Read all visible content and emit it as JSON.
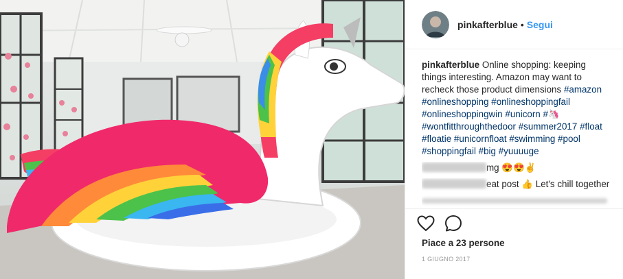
{
  "header": {
    "username": "pinkafterblue",
    "separator": "•",
    "follow_label": "Segui"
  },
  "caption": {
    "username": "pinkafterblue",
    "text": "Online shopping: keeping things interesting. Amazon may want to recheck those product dimensions",
    "hashtags": [
      "#amazon",
      "#onlineshopping",
      "#onlineshoppingfail",
      "#onlineshoppingwin",
      "#unicorn",
      "#🦄",
      "#wontfitthroughthedoor",
      "#summer2017",
      "#float",
      "#floatie",
      "#unicornfloat",
      "#swimming",
      "#pool",
      "#shoppingfail",
      "#big",
      "#yuuuuge"
    ]
  },
  "comments": [
    {
      "text_suffix": "mg 😍😍✌"
    },
    {
      "text_suffix": "eat post 👍 Let's chill together"
    }
  ],
  "likes": {
    "text": "Piace a 23 persone"
  },
  "date": {
    "text": "1 GIUGNO 2017"
  },
  "icons": {
    "like": "heart-icon",
    "comment": "comment-bubble-icon"
  },
  "colors": {
    "link": "#3897f0",
    "hashtag": "#003569",
    "meta": "#999999"
  }
}
